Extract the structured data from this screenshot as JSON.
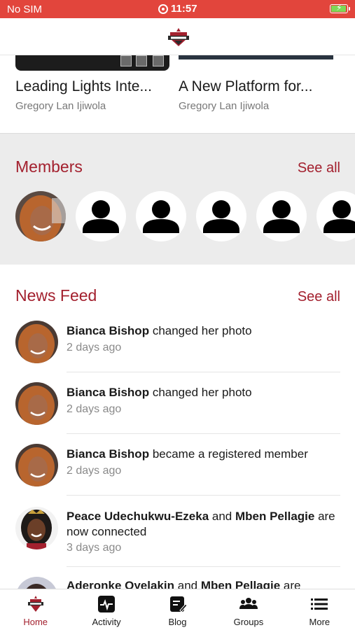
{
  "status_bar": {
    "carrier": "No SIM",
    "time": "11:57",
    "battery_level": 0.85,
    "battery_color": "#7ed957",
    "background": "#e2453c"
  },
  "header": {
    "logo_icon": "organization-crest-logo"
  },
  "courses": [
    {
      "title": "Leading Lights Inte...",
      "author": "Gregory Lan Ijiwola"
    },
    {
      "title": "A New Platform for...",
      "author": "Gregory Lan Ijiwola"
    }
  ],
  "members": {
    "title": "Members",
    "see_all": "See all",
    "avatars": [
      {
        "type": "photo",
        "icon": "member-photo"
      },
      {
        "type": "placeholder",
        "icon": "person-icon"
      },
      {
        "type": "placeholder",
        "icon": "person-icon"
      },
      {
        "type": "placeholder",
        "icon": "person-icon"
      },
      {
        "type": "placeholder",
        "icon": "person-icon"
      },
      {
        "type": "placeholder",
        "icon": "person-icon"
      }
    ]
  },
  "news_feed": {
    "title": "News Feed",
    "see_all": "See all",
    "items": [
      {
        "actor": "Bianca Bishop",
        "action": " changed her photo",
        "time": "2 days ago"
      },
      {
        "actor": "Bianca Bishop",
        "action": " changed her photo",
        "time": "2 days ago"
      },
      {
        "actor": "Bianca Bishop",
        "action": " became a registered member",
        "time": "2 days ago"
      },
      {
        "actor": "Peace Udechukwu-Ezeka",
        "connector": " and ",
        "actor2": "Mben Pellagie",
        "action": " are now connected",
        "time": "3 days ago"
      },
      {
        "actor": "Aderonke Oyelakin",
        "connector": " and ",
        "actor2": "Mben Pellagie",
        "action": " are"
      }
    ]
  },
  "tabs": [
    {
      "label": "Home",
      "icon": "home-logo-icon",
      "active": true
    },
    {
      "label": "Activity",
      "icon": "activity-pulse-icon",
      "active": false
    },
    {
      "label": "Blog",
      "icon": "blog-edit-icon",
      "active": false
    },
    {
      "label": "Groups",
      "icon": "groups-people-icon",
      "active": false
    },
    {
      "label": "More",
      "icon": "menu-list-icon",
      "active": false
    }
  ],
  "colors": {
    "accent": "#a3202e",
    "section_bg": "#ececec",
    "muted_text": "#8a8a8a"
  }
}
